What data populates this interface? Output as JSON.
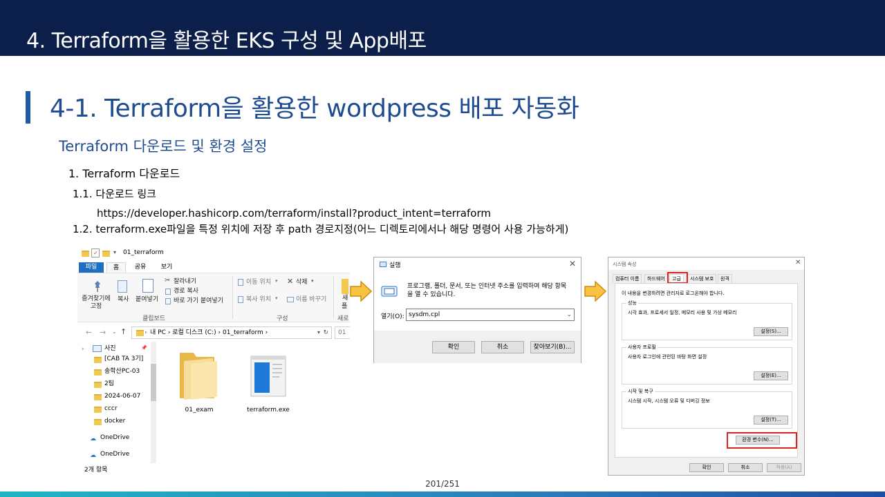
{
  "header": {
    "title": "4. Terraform을 활용한 EKS 구성 및 App배포"
  },
  "section": {
    "title": "4-1. Terraform을 활용한 wordpress 배포 자동화",
    "subtitle": "Terraform 다운로드 및 환경 설정"
  },
  "steps": {
    "heading": "1. Terraform 다운로드",
    "step_1_1": "1.1. 다운로드 링크",
    "link": "https://developer.hashicorp.com/terraform/install?product_intent=terraform",
    "step_1_2": "1.2. terraform.exe파일을 특정 위치에 저장 후 path 경로지정(어느 디렉토리에서나 해당 명령어 사용 가능하게)"
  },
  "explorer": {
    "title": "01_terraform",
    "tabs": [
      "파일",
      "홈",
      "공유",
      "보기"
    ],
    "ribbon": {
      "pin": "즐겨찾기에\n고정",
      "copy": "복사",
      "paste": "붙여넣기",
      "cut": "잘라내기",
      "copy_path": "경로 복사",
      "paste_shortcut": "바로 가기 붙여넣기",
      "move_to": "이동 위치",
      "delete": "삭제",
      "copy_to": "복사 위치",
      "rename": "이름 바꾸기",
      "group_clipboard": "클립보드",
      "group_organize": "구성",
      "group_new_1": "새",
      "group_new_2": "폴",
      "group_new_3": "새로"
    },
    "address": [
      "내 PC",
      "로컬 디스크 (C:)",
      "01_terraform"
    ],
    "address_search": "01",
    "nav_items": [
      "사진",
      "[CAB TA 3기]",
      "송학산PC-03",
      "2팀",
      "2024-06-07",
      "cccr",
      "docker",
      "OneDrive",
      "OneDrive"
    ],
    "files": [
      "01_exam",
      "terraform.exe"
    ],
    "status": "2개 항목"
  },
  "run_dialog": {
    "title": "실행",
    "description": "프로그램, 폴더, 문서, 또는 인터넷 주소를 입력하여 해당 항목을 열 수 있습니다.",
    "open_label": "열기(O):",
    "open_value": "sysdm.cpl",
    "ok": "확인",
    "cancel": "취소",
    "browse": "찾아보기(B)..."
  },
  "system_properties": {
    "title": "시스템 속성",
    "tabs": [
      "컴퓨터 이름",
      "하드웨어",
      "고급",
      "시스템 보호",
      "원격"
    ],
    "admin_note": "이 내용을 변경하려면 관리자로 로그온해야 합니다.",
    "groups": [
      {
        "title": "성능",
        "desc": "시각 효과, 프로세서 일정, 메모리 사용 및 가상 메모리",
        "button": "설정(S)..."
      },
      {
        "title": "사용자 프로필",
        "desc": "사용자 로그인에 관련된 바탕 화면 설정",
        "button": "설정(E)..."
      },
      {
        "title": "시작 및 복구",
        "desc": "시스템 시작, 시스템 오류 및 디버깅 정보",
        "button": "설정(T)..."
      }
    ],
    "env_button": "환경 변수(N)...",
    "ok": "확인",
    "cancel": "취소",
    "apply": "적용(A)"
  },
  "footer": {
    "page": "201/251"
  }
}
